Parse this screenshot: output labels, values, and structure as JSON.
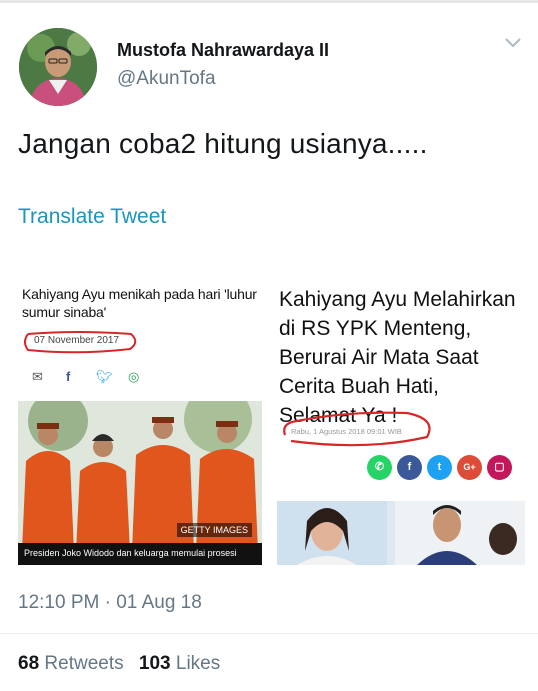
{
  "author": {
    "name": "Mustofa Nahrawardaya II",
    "handle": "@AkunTofa"
  },
  "tweet": {
    "text": "Jangan coba2 hitung usianya.....",
    "translate_label": "Translate Tweet",
    "timestamp": "12:10 PM · 01 Aug 18"
  },
  "stats": {
    "retweets_count": "68",
    "retweets_label": "Retweets",
    "likes_count": "103",
    "likes_label": "Likes"
  },
  "cards": {
    "left": {
      "title": "Kahiyang Ayu menikah pada hari 'luhur sumur sinaba'",
      "date": "07 November 2017",
      "photo_credit": "GETTY IMAGES",
      "caption": "Presiden Joko Widodo dan keluarga memulai prosesi",
      "share_icons": [
        "mail-icon",
        "facebook-icon",
        "twitter-icon",
        "whatsapp-icon"
      ]
    },
    "right": {
      "title": "Kahiyang Ayu Melahirkan di RS YPK Menteng, Berurai Air Mata Saat Cerita Buah Hati, Selamat Ya !",
      "date": "Rabu, 1 Agustus 2018 09:01 WIB",
      "social_icons": [
        "whatsapp-icon",
        "facebook-icon",
        "twitter-icon",
        "google-plus-icon",
        "comment-icon"
      ]
    }
  },
  "colors": {
    "link": "#1b95b8",
    "secondary_text": "#657786",
    "annotation_red": "#d62828",
    "whatsapp": "#25d366",
    "facebook": "#3b5998",
    "twitter": "#1da1f2",
    "google_plus": "#dd4b39",
    "comment": "#c2185b"
  }
}
